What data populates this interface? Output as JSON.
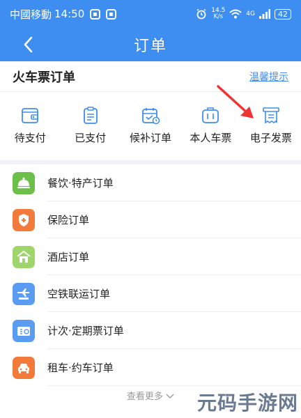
{
  "status_bar": {
    "carrier": "中國移動",
    "time": "14:50",
    "speed_value": "14.5",
    "speed_unit": "K/s",
    "network_label": "4G",
    "signal_suffix": "ıl",
    "battery": "42"
  },
  "nav": {
    "title": "订单"
  },
  "train_card": {
    "title": "火车票订单",
    "tip_link": "温馨提示",
    "categories": [
      {
        "label": "待支付",
        "icon": "wallet-icon"
      },
      {
        "label": "已支付",
        "icon": "clipboard-icon"
      },
      {
        "label": "候补订单",
        "icon": "calendar-icon"
      },
      {
        "label": "本人车票",
        "icon": "train-ticket-icon"
      },
      {
        "label": "电子发票",
        "icon": "invoice-icon"
      }
    ]
  },
  "orders": [
    {
      "label": "餐饮·特产订单",
      "icon": "food-cover-icon",
      "color": "#6cc04a"
    },
    {
      "label": "保险订单",
      "icon": "shield-plus-icon",
      "color": "#f27b3c"
    },
    {
      "label": "酒店订单",
      "icon": "hotel-icon",
      "color": "#9fd66c"
    },
    {
      "label": "空铁联运订单",
      "icon": "plane-train-icon",
      "color": "#5a9cf2"
    },
    {
      "label": "计次·定期票订单",
      "icon": "ticket-pass-icon",
      "color": "#5a9cf2"
    },
    {
      "label": "租车·约车订单",
      "icon": "car-icon",
      "color": "#f27b3c"
    }
  ],
  "more_label": "查看更多",
  "watermark": "元码手游网",
  "colors": {
    "primary": "#3d8ef0",
    "annotation": "#ee3333"
  }
}
